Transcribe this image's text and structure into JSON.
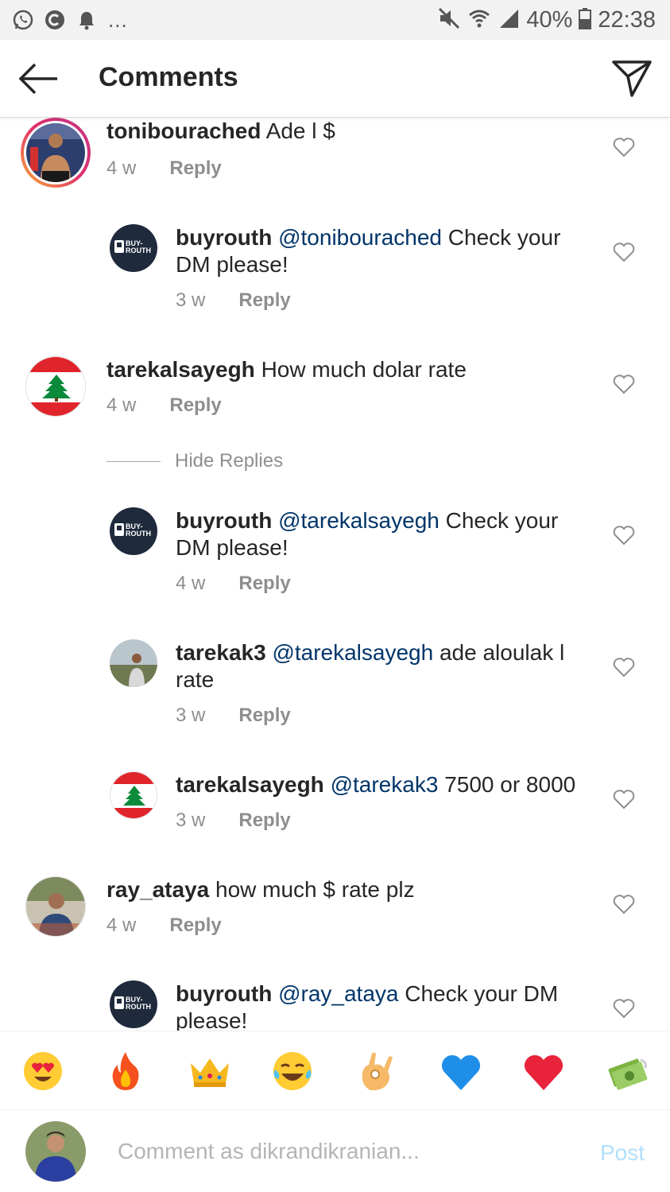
{
  "status_bar": {
    "battery": "40%",
    "time": "22:38",
    "left_icons": [
      "whatsapp-icon",
      "c-app-icon",
      "notification-bell-icon"
    ],
    "more": "...",
    "right_icons": [
      "mute-icon",
      "wifi-icon",
      "signal-icon",
      "battery-icon"
    ]
  },
  "header": {
    "title": "Comments",
    "back_icon": "back-arrow-icon",
    "share_icon": "direct-send-icon"
  },
  "comments": [
    {
      "user": "tonibourached",
      "mention": "",
      "text": "Ade l $",
      "age": "4 w",
      "reply": "Reply",
      "avatar": "boxer-photo",
      "indent": false
    },
    {
      "user": "buyrouth",
      "mention": "@tonibourached",
      "text": "Check your DM please!",
      "age": "3 w",
      "reply": "Reply",
      "avatar": "buyrouth-logo",
      "indent": true
    },
    {
      "user": "tarekalsayegh",
      "mention": "",
      "text": "How much dolar rate",
      "age": "4 w",
      "reply": "Reply",
      "avatar": "lebanon-flag",
      "indent": false
    },
    {
      "user": "buyrouth",
      "mention": "@tarekalsayegh",
      "text": "Check your DM please!",
      "age": "4 w",
      "reply": "Reply",
      "avatar": "buyrouth-logo",
      "indent": true
    },
    {
      "user": "tarekak3",
      "mention": "@tarekalsayegh",
      "text": "ade aloulak l rate",
      "age": "3 w",
      "reply": "Reply",
      "avatar": "person-photo",
      "indent": true
    },
    {
      "user": "tarekalsayegh",
      "mention": "@tarekak3",
      "text": "7500 or 8000",
      "age": "3 w",
      "reply": "Reply",
      "avatar": "lebanon-flag",
      "indent": true
    },
    {
      "user": "ray_ataya",
      "mention": "",
      "text": "how much $ rate plz",
      "age": "4 w",
      "reply": "Reply",
      "avatar": "person-photo",
      "indent": false
    },
    {
      "user": "buyrouth",
      "mention": "@ray_ataya",
      "text": "Check your DM please!",
      "age": "",
      "reply": "",
      "avatar": "buyrouth-logo",
      "indent": true
    }
  ],
  "hide_replies": "Hide Replies",
  "logo_text": {
    "line1": "BUY-",
    "line2": "ROUTH"
  },
  "emoji_bar": [
    "heart-eyes-emoji",
    "fire-emoji",
    "crown-emoji",
    "tears-of-joy-emoji",
    "ok-hand-emoji",
    "blue-heart-emoji",
    "red-heart-emoji",
    "money-emoji"
  ],
  "composer": {
    "placeholder": "Comment as dikrandikranian...",
    "post_label": "Post"
  },
  "colors": {
    "mention": "#003569",
    "meta": "#8e8e8e",
    "post_disabled": "#b2dffc",
    "lebanon_red": "#e0242b",
    "cedar_green": "#0a8a3a",
    "buyrouth_navy": "#1f2a3c"
  }
}
